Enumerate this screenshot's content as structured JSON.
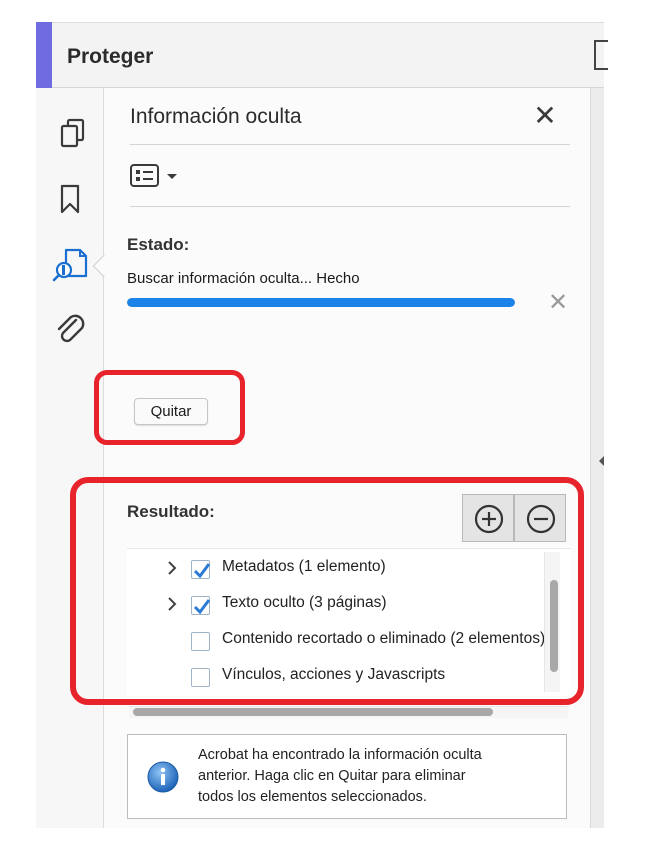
{
  "tool_header": {
    "title": "Proteger",
    "accent_color": "#6f6be0"
  },
  "left_rail": {
    "icons": [
      "pages-icon",
      "bookmark-icon",
      "hidden-info-icon",
      "paperclip-icon"
    ],
    "active": "hidden-info-icon"
  },
  "panel": {
    "title": "Información oculta",
    "close_glyph": "✕",
    "status_label": "Estado:",
    "status_text": "Buscar información oculta... Hecho",
    "progress": 1.0,
    "cancel_glyph": "✕",
    "remove_button": "Quitar",
    "results_label": "Resultado:",
    "results": [
      {
        "label": "Metadatos (1 elemento)",
        "checked": true,
        "expandable": true
      },
      {
        "label": "Texto oculto (3 páginas)",
        "checked": true,
        "expandable": true
      },
      {
        "label": "Contenido recortado o eliminado (2 elementos)",
        "checked": false,
        "expandable": false
      },
      {
        "label": "Vínculos, acciones y Javascripts",
        "checked": false,
        "expandable": false
      }
    ],
    "info_lines": [
      "Acrobat ha encontrado la información oculta",
      "anterior. Haga clic en Quitar para eliminar",
      "todos los elementos seleccionados."
    ]
  },
  "colors": {
    "highlight": "#e7232b",
    "progress": "#1b82e8",
    "active_icon": "#1b6fd1"
  }
}
